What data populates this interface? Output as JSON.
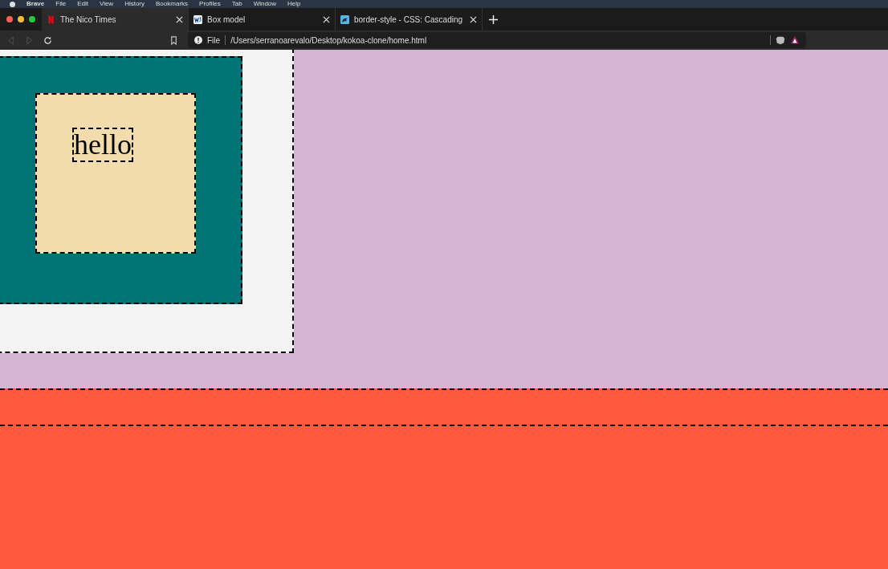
{
  "menu_bar": [
    "Brave",
    "File",
    "Edit",
    "View",
    "History",
    "Bookmarks",
    "Profiles",
    "Tab",
    "Window",
    "Help"
  ],
  "tabs": [
    {
      "title": "The Nico Times",
      "selected": true,
      "kind": "n"
    },
    {
      "title": "Box model",
      "selected": false,
      "kind": "w3"
    },
    {
      "title": "border-style - CSS: Cascading",
      "selected": false,
      "kind": "mdn"
    }
  ],
  "address_bar": {
    "scheme_label": "File",
    "url": "/Users/serranoarevalo/Desktop/kokoa-clone/home.html"
  },
  "page": {
    "text": "hello"
  }
}
